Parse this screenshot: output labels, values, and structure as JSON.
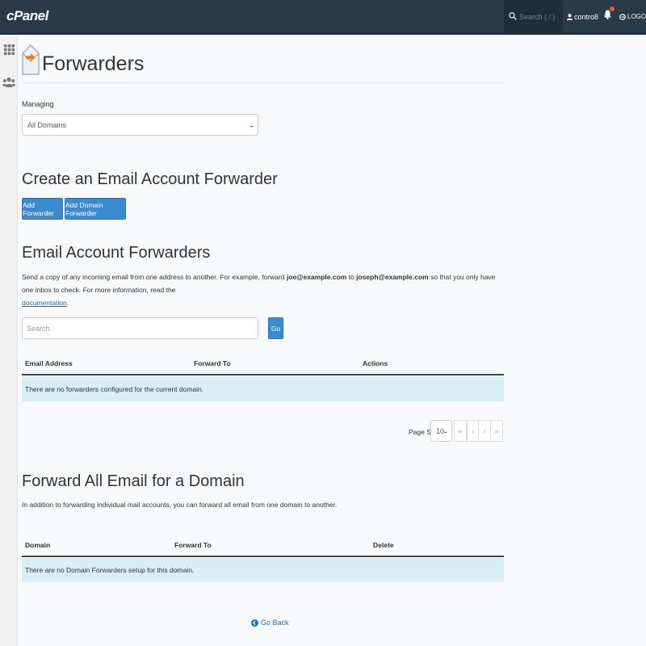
{
  "header": {
    "logo": "cPanel",
    "search_placeholder": "Search ( / )",
    "username": "contro8",
    "user_caret": "▼",
    "logout_label": "LOGOUT"
  },
  "page": {
    "title": "Forwarders",
    "managing_label": "Managing",
    "managing_selected": "All Domains"
  },
  "create": {
    "heading": "Create an Email Account Forwarder",
    "add_forwarder_label": "Add Forwarder",
    "add_domain_forwarder_label": "Add Domain Forwarder"
  },
  "email_forwarders": {
    "heading": "Email Account Forwarders",
    "desc_1": "Send a copy of any incoming email from one address to another. For example, forward ",
    "example_from": "joe@example.com",
    "desc_2": " to ",
    "example_to": "joseph@example.com",
    "desc_3": " so that you only have one inbox to check. For more information, read the",
    "doc_link": "documentation",
    "desc_end": ".",
    "search_placeholder": "Search",
    "go_label": "Go",
    "columns": [
      "Email Address",
      "Forward To",
      "Actions"
    ],
    "empty_message": "There are no forwarders configured for the current domain.",
    "page_size_label": "Page Size",
    "page_size_value": "10",
    "pager": [
      "«",
      "‹",
      "›",
      "»"
    ]
  },
  "domain_forwarders": {
    "heading": "Forward All Email for a Domain",
    "description": "In addition to forwarding individual mail accounts, you can forward all email from one domain to another.",
    "columns": [
      "Domain",
      "Forward To",
      "Delete"
    ],
    "empty_message": "There are no Domain Forwarders setup for this domain."
  },
  "footer": {
    "go_back_label": "Go Back"
  },
  "colors": {
    "topbar": "#293a4a",
    "primary_button": "#3b8bd0",
    "info_row": "#d9edf7",
    "link": "#1a6fb6"
  }
}
